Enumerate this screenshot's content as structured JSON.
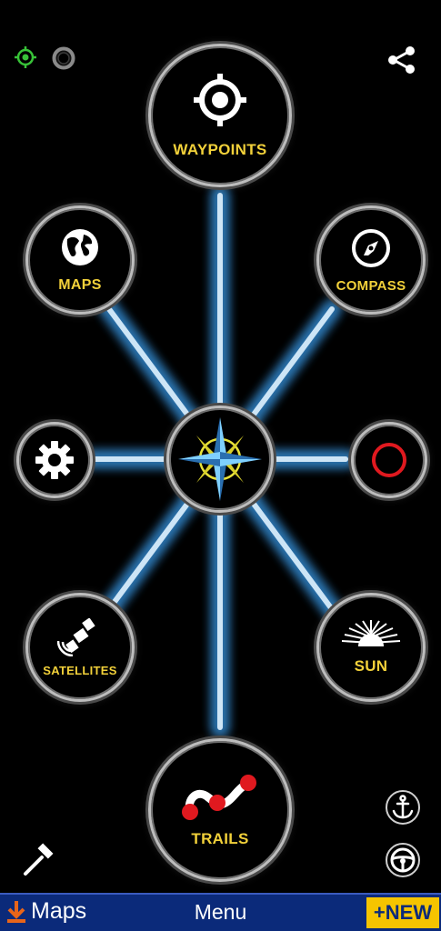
{
  "nodes": {
    "waypoints": {
      "label": "WAYPOINTS",
      "icon": "crosshair-icon"
    },
    "maps": {
      "label": "MAPS",
      "icon": "globe-icon"
    },
    "compass": {
      "label": "COMPASS",
      "icon": "compass-needle-icon"
    },
    "settings": {
      "label": "",
      "icon": "gear-icon"
    },
    "center": {
      "label": "",
      "icon": "compass-rose-icon"
    },
    "record": {
      "label": "",
      "icon": "record-circle-icon"
    },
    "satellites": {
      "label": "SATELLITES",
      "icon": "satellite-icon"
    },
    "sun": {
      "label": "SUN",
      "icon": "sunrise-icon"
    },
    "trails": {
      "label": "TRAILS",
      "icon": "trail-path-icon"
    }
  },
  "top_icons": {
    "gps_status": "gps-fix-icon",
    "secondary_status": "ring-icon",
    "share": "share-icon"
  },
  "side_icons": {
    "anchor": "anchor-icon",
    "steering": "steering-wheel-icon",
    "tools": "hammer-icon"
  },
  "bottom_bar": {
    "maps_label": "Maps",
    "menu_label": "Menu",
    "new_label": "+NEW"
  },
  "colors": {
    "label_yellow": "#f2d13a",
    "spoke_blue": "#4aa6e0",
    "bar_blue": "#0b2a7a",
    "new_yellow": "#f5c400",
    "record_red": "#e0191f",
    "trail_red": "#e0191f",
    "gps_green": "#38c238",
    "download_orange": "#e8651a"
  }
}
